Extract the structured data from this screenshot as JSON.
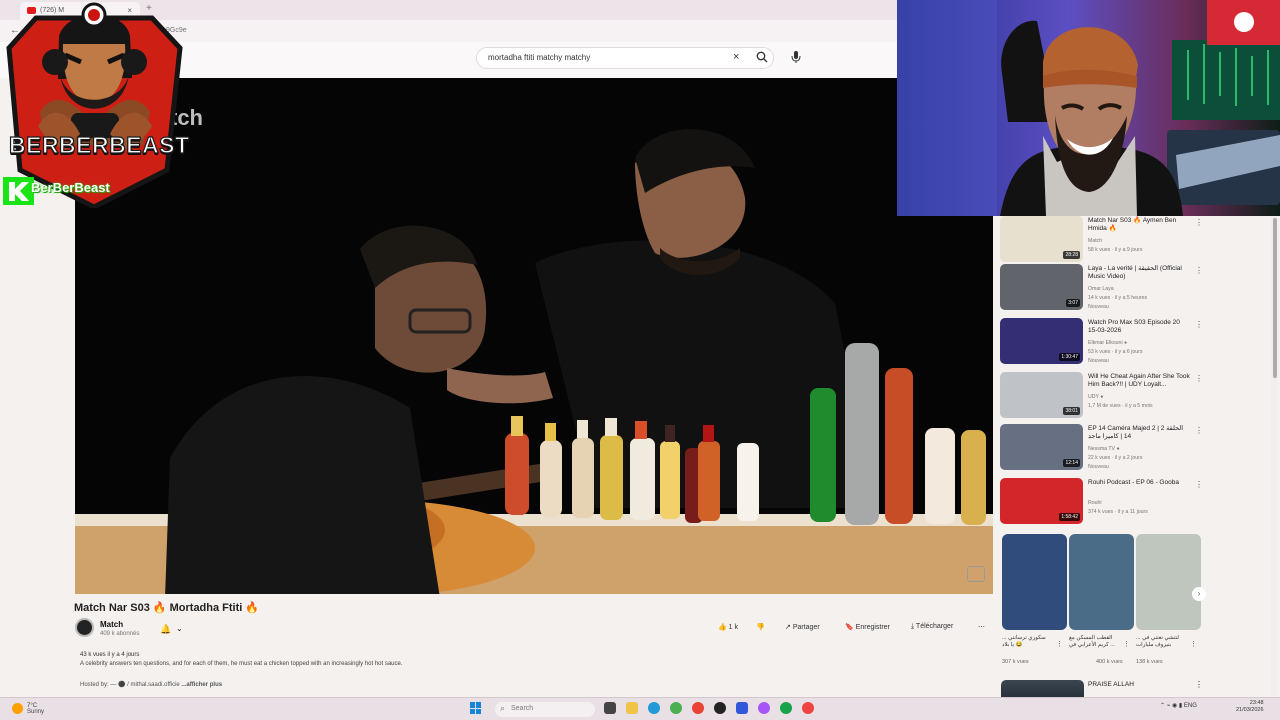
{
  "browser": {
    "tab_title": "(726) M",
    "url": "f2Ac9Gc9e",
    "search_query": "mortadha ftiti matchy matchy"
  },
  "video": {
    "watermark": "tch",
    "title": "Match Nar S03 🔥 Mortadha Ftiti 🔥",
    "channel": "Match",
    "subscribers": "409 k abonnés",
    "likes": "1 k",
    "share": "Partager",
    "save": "Enregistrer",
    "download": "Télécharger",
    "views_date": "43 k vues  il y a 4 jours",
    "description": "A celebrity answers ten questions, and for each of them, he must eat a chicken topped with an increasingly hot hot sauce.",
    "hosted_by": "Hosted by:  —  ⚫ / mithal.saadi.officie",
    "more": "...afficher plus"
  },
  "overlay": {
    "brand": "BERBERBEAST",
    "handle": "BerBerBeast"
  },
  "recommendations": [
    {
      "title": "Match Nar S03 🔥 Aymen Ben Hmida 🔥",
      "channel": "Match",
      "meta": "58 k vues · il y a 9 jours",
      "duration": "28:28",
      "color": "#e8e0cf"
    },
    {
      "title": "Laya - La verité | الحقيقة (Official Music Video)",
      "channel": "Omar Laya",
      "meta": "14 k vues · il y a 5 heures",
      "badge": "Nouveau",
      "duration": "3:07",
      "color": "#61656b"
    },
    {
      "title": "Watch Pro Max S03 Episode 20 15-03-2026",
      "channel": "Elkmar Elkouni ●",
      "meta": "53 k vues · il y a 6 jours",
      "badge": "Nouveau",
      "duration": "1:30:47",
      "color": "#342e75"
    },
    {
      "title": "Will He Cheat Again After She Took Him Back?!! | UDY Loyalt...",
      "channel": "UDY ●",
      "meta": "1,7 M de vues · il y a 5 mois",
      "duration": "38:01",
      "color": "#bfc3c8"
    },
    {
      "title": "EP 14 Caméra Majed 2 | 2 الحلقة 14 | كاميرا ماجد",
      "channel": "Nessma TV ●",
      "meta": "22 k vues · il y a 2 jours",
      "badge": "Nouveau",
      "duration": "12:14",
      "color": "#677083"
    },
    {
      "title": "Rouhi Podcast - EP 06 - Gooba",
      "channel": "Rouhi",
      "meta": "374 k vues · il y a 11 jours",
      "duration": "1:58:42",
      "color": "#d3262a"
    }
  ],
  "shorts": [
    {
      "title": "سكوري ترسانتي ... يا بلاد 😂",
      "views": "307 k vues",
      "color": "#2f4c7d"
    },
    {
      "title": "القطب المسكن مع ... كريم الأعرابي في",
      "views": "400 k vues",
      "color": "#4b6c86"
    },
    {
      "title": "لتتشي تعتني في ... بتيروف مليارات",
      "views": "138 k vues",
      "color": "#bfc6bd"
    }
  ],
  "next_item": {
    "title": "PRAISE ALLAH"
  },
  "taskbar": {
    "weather_temp": "7°C",
    "weather_text": "Sunny",
    "search": "Search",
    "lang": "ENG",
    "lang2": "US",
    "time": "23:48",
    "date": "21/03/2026"
  }
}
